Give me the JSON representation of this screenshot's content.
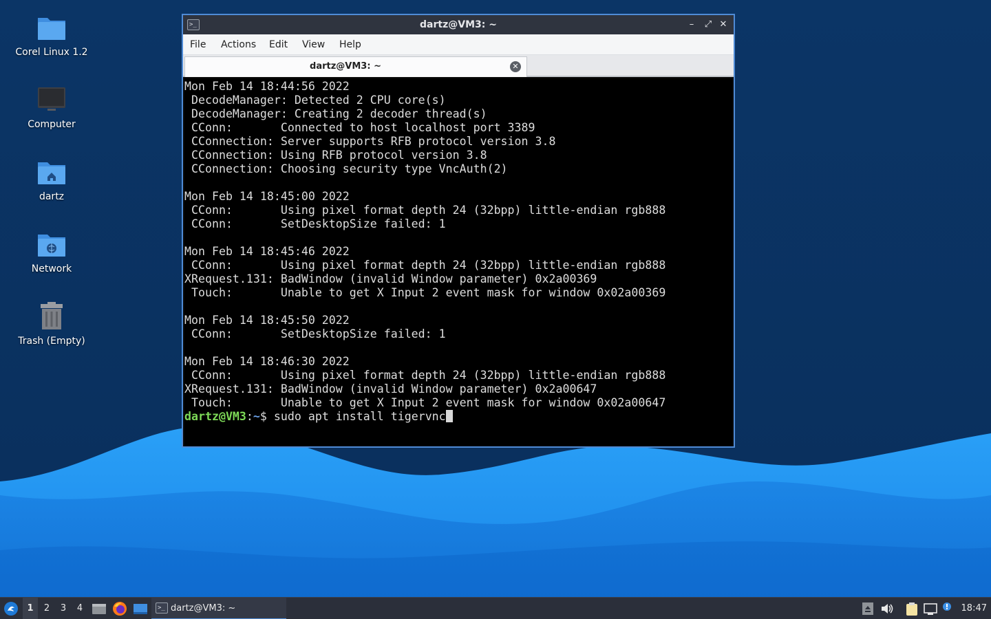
{
  "desktop": {
    "icons": [
      {
        "label": "Corel Linux 1.2",
        "icon": "folder-icon"
      },
      {
        "label": "Computer",
        "icon": "computer-icon"
      },
      {
        "label": "dartz",
        "icon": "home-folder-icon"
      },
      {
        "label": "Network",
        "icon": "network-folder-icon"
      },
      {
        "label": "Trash (Empty)",
        "icon": "trash-icon"
      }
    ]
  },
  "window": {
    "title": "dartz@VM3: ~",
    "controls": {
      "minimize": "–",
      "maximize": "⤢",
      "close": "✕"
    },
    "menu": [
      "File",
      "Actions",
      "Edit",
      "View",
      "Help"
    ],
    "tab": {
      "title": "dartz@VM3: ~",
      "close": "✕"
    },
    "terminal": {
      "lines": [
        "Mon Feb 14 18:44:56 2022",
        " DecodeManager: Detected 2 CPU core(s)",
        " DecodeManager: Creating 2 decoder thread(s)",
        " CConn:       Connected to host localhost port 3389",
        " CConnection: Server supports RFB protocol version 3.8",
        " CConnection: Using RFB protocol version 3.8",
        " CConnection: Choosing security type VncAuth(2)",
        "",
        "Mon Feb 14 18:45:00 2022",
        " CConn:       Using pixel format depth 24 (32bpp) little-endian rgb888",
        " CConn:       SetDesktopSize failed: 1",
        "",
        "Mon Feb 14 18:45:46 2022",
        " CConn:       Using pixel format depth 24 (32bpp) little-endian rgb888",
        "XRequest.131: BadWindow (invalid Window parameter) 0x2a00369",
        " Touch:       Unable to get X Input 2 event mask for window 0x02a00369",
        "",
        "Mon Feb 14 18:45:50 2022",
        " CConn:       SetDesktopSize failed: 1",
        "",
        "Mon Feb 14 18:46:30 2022",
        " CConn:       Using pixel format depth 24 (32bpp) little-endian rgb888",
        "XRequest.131: BadWindow (invalid Window parameter) 0x2a00647",
        " Touch:       Unable to get X Input 2 event mask for window 0x02a00647"
      ],
      "prompt": {
        "user": "dartz@VM3",
        "sep": ":",
        "path": "~",
        "symbol": "$ ",
        "command": "sudo apt install tigervnc"
      }
    }
  },
  "taskbar": {
    "workspaces": [
      "1",
      "2",
      "3",
      "4"
    ],
    "active_workspace": "1",
    "task": {
      "label": "dartz@VM3: ~"
    },
    "clock": "18:47"
  },
  "colors": {
    "wallpaper_dark": "#0c3565",
    "wave_light": "#1f8ff0",
    "wave_mid": "#0a6fd8",
    "window_border": "#4f8bd6",
    "prompt_user": "#7dd957",
    "prompt_path": "#6aa0e8"
  }
}
